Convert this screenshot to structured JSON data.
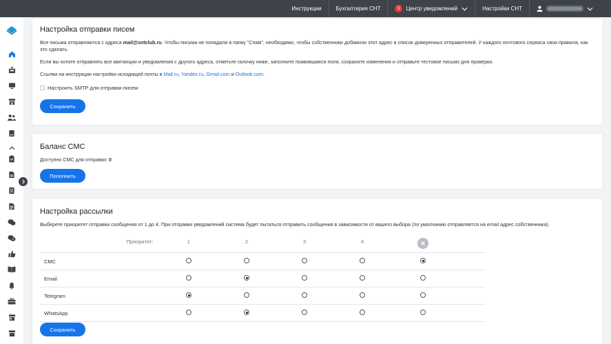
{
  "topbar": {
    "nav": [
      "Инструкции",
      "Бухгалтерия СНТ"
    ],
    "notifications_label": "Центр уведомлений",
    "notifications_count": "5",
    "settings_label": "Настройки СНТ"
  },
  "sidebar": {
    "icons": [
      "home-icon",
      "inbox-icon",
      "monitor-icon",
      "store-icon",
      "users-icon",
      "book-icon",
      "chevron-up-icon",
      "clipboard-icon",
      "document-icon",
      "percent-icon",
      "file-icon",
      "chat-icon",
      "chat-alt-icon",
      "thumbs-up-icon",
      "open-book-icon",
      "bell-icon",
      "briefcase-icon",
      "store-alt-icon"
    ]
  },
  "email_settings": {
    "title": "Настройка отправки писем",
    "p1_pre": "Все письма отправляются с адреса ",
    "p1_email": "mail@sntclub.ru",
    "p1_post": ". Чтобы письма не попадали в папку \"Спам\", необходимо, чтобы собственники добавили этот адрес в список доверенных отправителей. У каждого почтового сервиса свои правила, как это сделать.",
    "p2": "Если вы хотите отправлять все квитанции и уведомления с другого адреса, отметьте галочку ниже, заполните появившиеся поля, сохраните изменения и отправьте тестовое письмо для проверки.",
    "p3_pre": "Ссылки на инструкции настройки исходящей почты в ",
    "links": [
      "Mail.ru",
      "Yandex.ru",
      "Gmail.com",
      "Outlook.com"
    ],
    "sep": ", ",
    "and": " и ",
    "dot": ".",
    "smtp_label": "Настроить SMTP для отправки писем",
    "save_label": "Сохранить"
  },
  "sms_balance": {
    "title": "Баланс СМС",
    "available_label": "Доступно СМС для отправки: ",
    "available_value": "0",
    "topup_label": "Пополнить"
  },
  "mailing": {
    "title": "Настройка рассылки",
    "description": "Выберете приоритет отправки сообщения от 1 до 4. При отправки уведомлений система будет пытаться отправить сообщения в зависимости от вашего выбора (по умолчанию отправляется на email адрес собственника).",
    "priority_label": "Приоритет:",
    "columns": [
      "1",
      "2",
      "3",
      "4"
    ],
    "rows": [
      {
        "name": "СМС",
        "selected": 4
      },
      {
        "name": "Email",
        "selected": 1
      },
      {
        "name": "Telegram",
        "selected": 0
      },
      {
        "name": "WhatsApp",
        "selected": 1
      }
    ],
    "save_label": "Сохранить"
  }
}
